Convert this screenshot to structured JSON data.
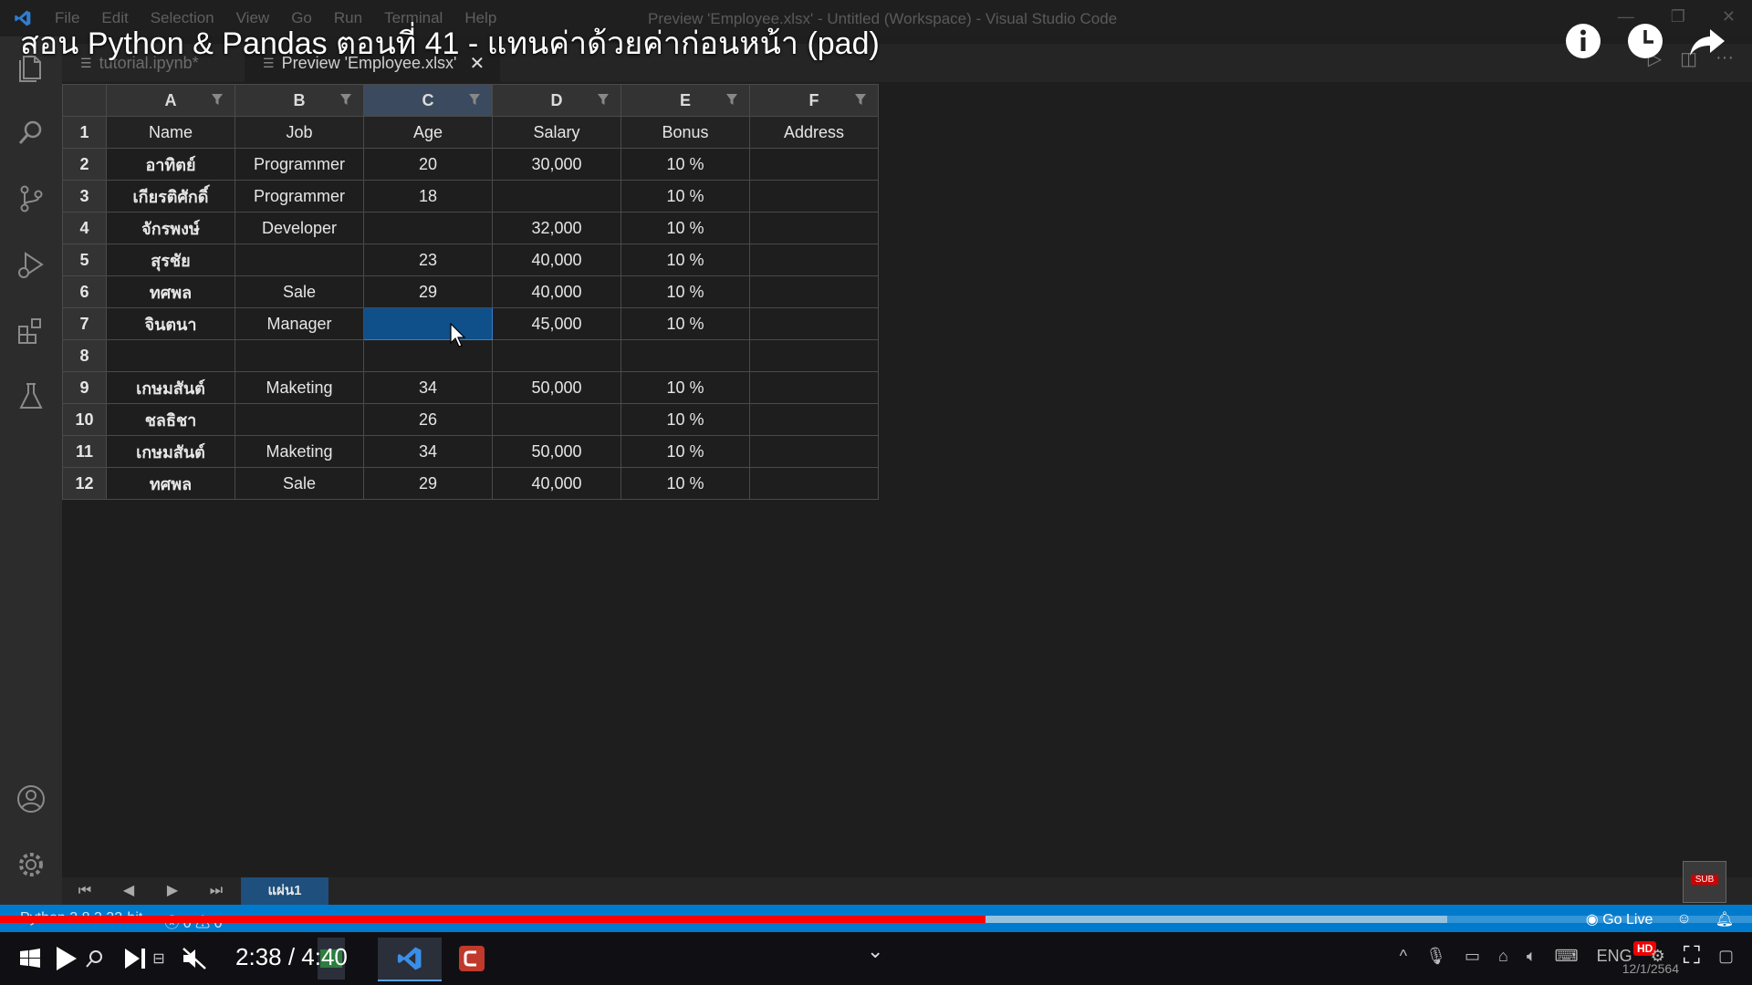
{
  "window": {
    "title": "Preview 'Employee.xlsx' - Untitled (Workspace) - Visual Studio Code",
    "menu": [
      "File",
      "Edit",
      "Selection",
      "View",
      "Go",
      "Run",
      "Terminal",
      "Help"
    ]
  },
  "tabs": [
    {
      "label": "tutorial.ipynb*",
      "active": false
    },
    {
      "label": "Preview 'Employee.xlsx'",
      "active": true
    }
  ],
  "sheet": {
    "columns": [
      "A",
      "B",
      "C",
      "D",
      "E",
      "F"
    ],
    "selected_column": "C",
    "rows": [
      {
        "num": "1",
        "cells": [
          "Name",
          "Job",
          "Age",
          "Salary",
          "Bonus",
          "Address"
        ]
      },
      {
        "num": "2",
        "cells": [
          "อาทิตย์",
          "Programmer",
          "20",
          "30,000",
          "10 %",
          ""
        ]
      },
      {
        "num": "3",
        "cells": [
          "เกียรติศักดิ์",
          "Programmer",
          "18",
          "",
          "10 %",
          ""
        ]
      },
      {
        "num": "4",
        "cells": [
          "จักรพงษ์",
          "Developer",
          "",
          "32,000",
          "10 %",
          ""
        ]
      },
      {
        "num": "5",
        "cells": [
          "สุรชัย",
          "",
          "23",
          "40,000",
          "10 %",
          ""
        ]
      },
      {
        "num": "6",
        "cells": [
          "ทศพล",
          "Sale",
          "29",
          "40,000",
          "10 %",
          ""
        ]
      },
      {
        "num": "7",
        "cells": [
          "จินตนา",
          "Manager",
          "",
          "45,000",
          "10 %",
          ""
        ]
      },
      {
        "num": "8",
        "cells": [
          "",
          "",
          "",
          "",
          "",
          ""
        ]
      },
      {
        "num": "9",
        "cells": [
          "เกษมสันต์",
          "Maketing",
          "34",
          "50,000",
          "10 %",
          ""
        ]
      },
      {
        "num": "10",
        "cells": [
          "ชลธิชา",
          "",
          "26",
          "",
          "10 %",
          ""
        ]
      },
      {
        "num": "11",
        "cells": [
          "เกษมสันต์",
          "Maketing",
          "34",
          "50,000",
          "10 %",
          ""
        ]
      },
      {
        "num": "12",
        "cells": [
          "ทศพล",
          "Sale",
          "29",
          "40,000",
          "10 %",
          ""
        ]
      }
    ],
    "selected_cell": "C7",
    "sheet_tab": "แผ่น1"
  },
  "statusbar": {
    "python": "Python 3.8.3 32-bit",
    "problems": "0",
    "warnings": "0",
    "go_live": "Go Live"
  },
  "video": {
    "title": "สอน Python & Pandas ตอนที่ 41 - แทนค่าด้วยค่าก่อนหน้า (pad)",
    "time": "2:38 / 4:40",
    "played_fraction": 0.5625,
    "buffered_fraction": 0.826,
    "quality_badge": "HD",
    "subscribe_label": "SUB"
  },
  "taskbar": {
    "date": "12/1/2564",
    "lang": "ENG"
  },
  "colors": {
    "accent": "#007acc",
    "progress": "#ff0000",
    "selected_cell": "#0f4f8a"
  }
}
